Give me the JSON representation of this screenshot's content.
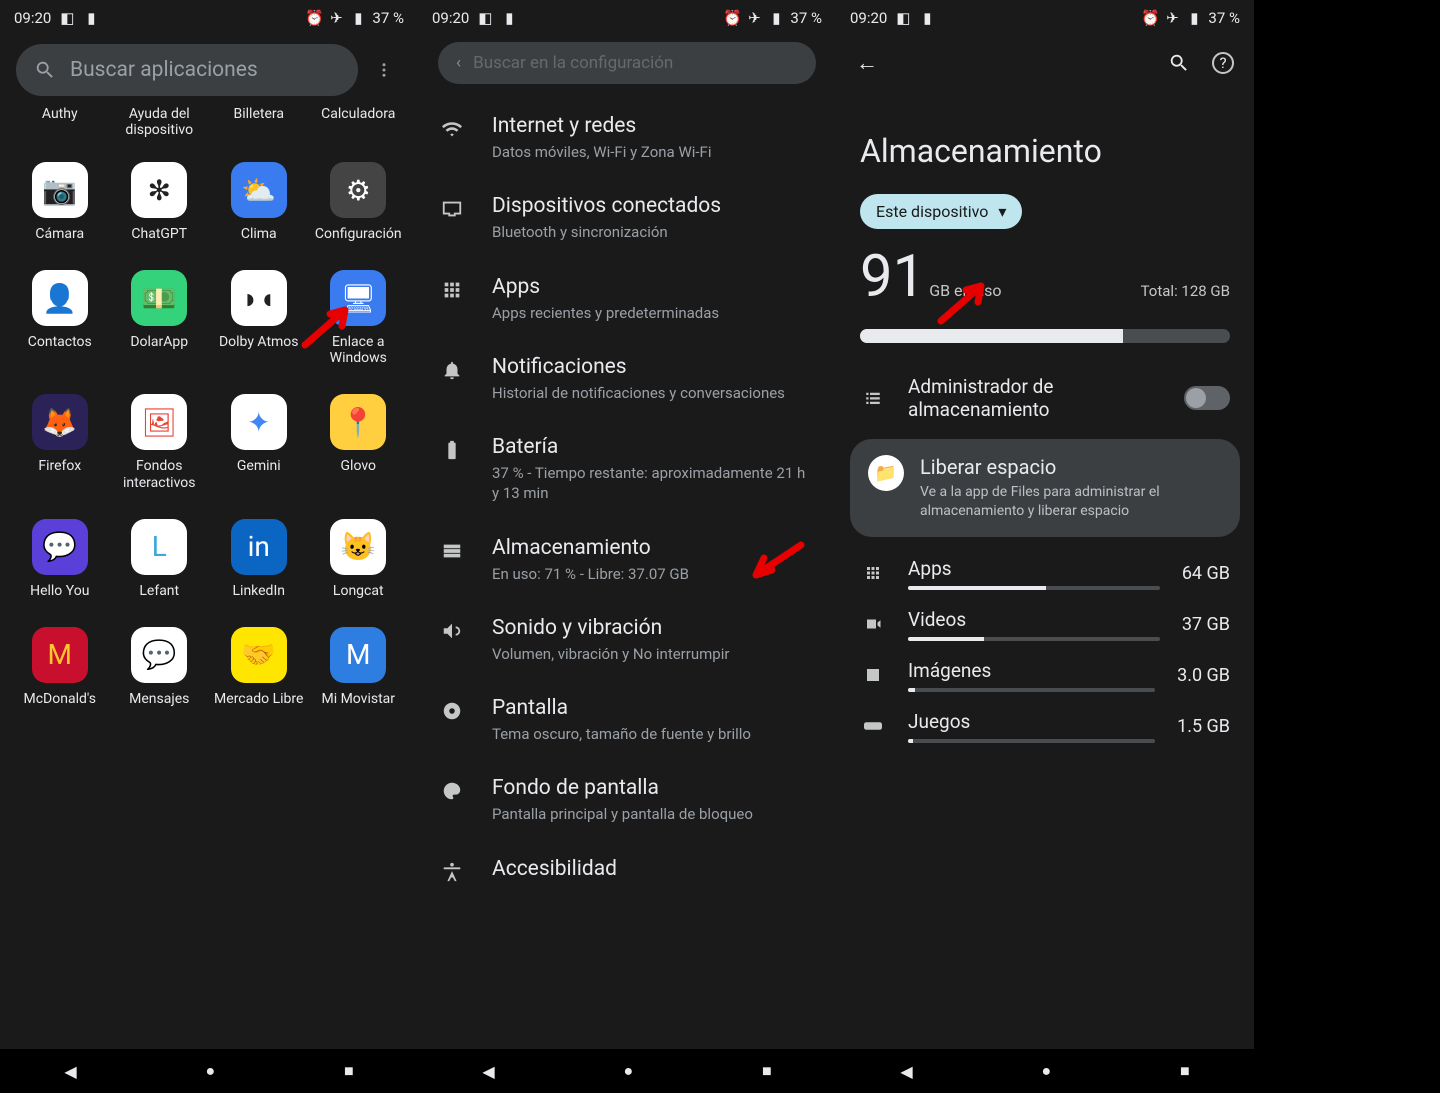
{
  "statusBar": {
    "time": "09:20",
    "battery": "37 %"
  },
  "panel1": {
    "searchPlaceholder": "Buscar aplicaciones",
    "topLabels": [
      "Authy",
      "Ayuda del dispositivo",
      "Billetera",
      "Calculadora"
    ],
    "apps": [
      {
        "label": "Cámara",
        "bg": "#ffffff",
        "fg": "#2a6cf0",
        "glyph": "📷"
      },
      {
        "label": "ChatGPT",
        "bg": "#ffffff",
        "fg": "#222",
        "glyph": "✻"
      },
      {
        "label": "Clima",
        "bg": "#3a7bf0",
        "fg": "#fff",
        "glyph": "⛅"
      },
      {
        "label": "Configuración",
        "bg": "#444",
        "fg": "#fff",
        "glyph": "⚙"
      },
      {
        "label": "Contactos",
        "bg": "#ffffff",
        "fg": "#1a73e8",
        "glyph": "👤"
      },
      {
        "label": "DolarApp",
        "bg": "#34d27b",
        "fg": "#fff",
        "glyph": "💵"
      },
      {
        "label": "Dolby Atmos",
        "bg": "#ffffff",
        "fg": "#222",
        "glyph": "◗◖"
      },
      {
        "label": "Enlace a Windows",
        "bg": "#3a7bf0",
        "fg": "#fff",
        "glyph": "🖥"
      },
      {
        "label": "Firefox",
        "bg": "#2b2258",
        "fg": "#ff8a00",
        "glyph": "🦊"
      },
      {
        "label": "Fondos interactivos",
        "bg": "#ffffff",
        "fg": "#ea4335",
        "glyph": "🖼"
      },
      {
        "label": "Gemini",
        "bg": "#ffffff",
        "fg": "#4285f4",
        "glyph": "✦"
      },
      {
        "label": "Glovo",
        "bg": "#ffcf3f",
        "fg": "#00a082",
        "glyph": "📍"
      },
      {
        "label": "Hello You",
        "bg": "#5b3fd9",
        "fg": "#fff",
        "glyph": "💬"
      },
      {
        "label": "Lefant",
        "bg": "#ffffff",
        "fg": "#3aa8d8",
        "glyph": "L"
      },
      {
        "label": "LinkedIn",
        "bg": "#0a66c2",
        "fg": "#fff",
        "glyph": "in"
      },
      {
        "label": "Longcat",
        "bg": "#ffffff",
        "fg": "#f0a020",
        "glyph": "😺"
      },
      {
        "label": "McDonald's",
        "bg": "#c8102e",
        "fg": "#ffc72c",
        "glyph": "M"
      },
      {
        "label": "Mensajes",
        "bg": "#ffffff",
        "fg": "#1a73e8",
        "glyph": "💬"
      },
      {
        "label": "Mercado Libre",
        "bg": "#ffe600",
        "fg": "#2d3277",
        "glyph": "🤝"
      },
      {
        "label": "Mi Movistar",
        "bg": "#2e7de1",
        "fg": "#fff",
        "glyph": "M"
      }
    ]
  },
  "panel2": {
    "searchPlaceholder": "Buscar en la configuración",
    "items": [
      {
        "icon": "wifi",
        "title": "Internet y redes",
        "sub": "Datos móviles, Wi-Fi y Zona Wi-Fi"
      },
      {
        "icon": "devices",
        "title": "Dispositivos conectados",
        "sub": "Bluetooth y sincronización"
      },
      {
        "icon": "apps",
        "title": "Apps",
        "sub": "Apps recientes y predeterminadas"
      },
      {
        "icon": "bell",
        "title": "Notificaciones",
        "sub": "Historial de notificaciones y conversaciones"
      },
      {
        "icon": "battery",
        "title": "Batería",
        "sub": "37 % - Tiempo restante: aproximadamente 21 h y 13 min"
      },
      {
        "icon": "storage",
        "title": "Almacenamiento",
        "sub": "En uso: 71 % - Libre: 37.07 GB"
      },
      {
        "icon": "volume",
        "title": "Sonido y vibración",
        "sub": "Volumen, vibración y No interrumpir"
      },
      {
        "icon": "display",
        "title": "Pantalla",
        "sub": "Tema oscuro, tamaño de fuente y brillo"
      },
      {
        "icon": "palette",
        "title": "Fondo de pantalla",
        "sub": "Pantalla principal y pantalla de bloqueo"
      },
      {
        "icon": "a11y",
        "title": "Accesibilidad",
        "sub": ""
      }
    ]
  },
  "panel3": {
    "title": "Almacenamiento",
    "chip": "Este dispositivo",
    "usedBig": "91",
    "usedSuffix": "GB en uso",
    "total": "Total: 128 GB",
    "barPercent": 71,
    "managerTitle": "Administrador de almacenamiento",
    "liberar": {
      "title": "Liberar espacio",
      "sub": "Ve a la app de Files para administrar el almacenamiento y liberar espacio"
    },
    "categories": [
      {
        "icon": "apps",
        "label": "Apps",
        "val": "64 GB",
        "pct": 55
      },
      {
        "icon": "video",
        "label": "Videos",
        "val": "37 GB",
        "pct": 30
      },
      {
        "icon": "image",
        "label": "Imágenes",
        "val": "3.0 GB",
        "pct": 3
      },
      {
        "icon": "games",
        "label": "Juegos",
        "val": "1.5 GB",
        "pct": 2
      }
    ]
  }
}
